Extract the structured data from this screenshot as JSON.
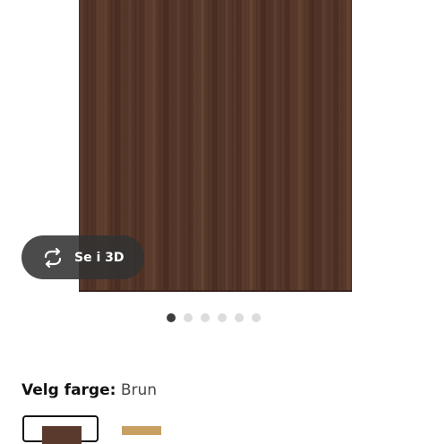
{
  "gallery": {
    "total_images": 6,
    "active_index": 0,
    "view_3d_label": "Se i 3D"
  },
  "colors": {
    "label": "Velg farge:",
    "selected_value": "Brun",
    "options": [
      {
        "name": "Brun",
        "swatch": "#5a3a2c",
        "selected": true
      },
      {
        "name": "",
        "swatch": "#c9a064",
        "selected": false
      }
    ]
  },
  "icons": {
    "view_3d": "rotate-arrows-icon"
  },
  "colors_theme": {
    "active_dot": "#3e3e3e",
    "inactive_dot": "#dcdcdc",
    "button_bg": "#323232"
  }
}
